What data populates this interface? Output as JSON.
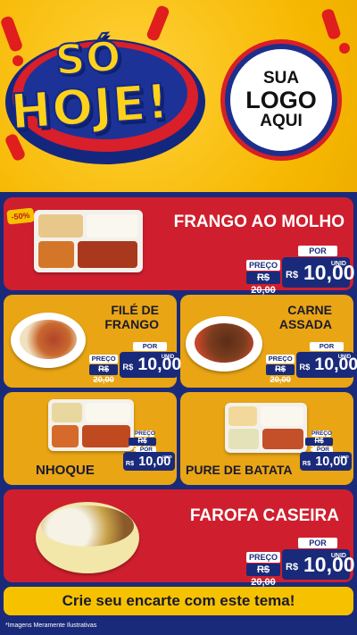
{
  "header": {
    "headline_line1": "SÓ",
    "headline_line2": "HOJE!",
    "logo_line1": "SUA",
    "logo_line2": "LOGO",
    "logo_line3": "AQUI"
  },
  "discount_badge": "-50%",
  "products": [
    {
      "name": "FRANGO AO MOLHO",
      "preco_label": "PREÇO",
      "old_price": "20,00",
      "por_label": "POR",
      "currency": "R$",
      "price": "10,00",
      "unit": "UNID"
    },
    {
      "name_line1": "FILÉ DE",
      "name_line2": "FRANGO",
      "preco_label": "PREÇO",
      "old_price": "20,00",
      "por_label": "POR",
      "currency": "R$",
      "price": "10,00",
      "unit": "UNID"
    },
    {
      "name_line1": "CARNE",
      "name_line2": "ASSADA",
      "preco_label": "PREÇO",
      "old_price": "20,00",
      "por_label": "POR",
      "currency": "R$",
      "price": "10,00",
      "unit": "UNID"
    },
    {
      "name": "NHOQUE",
      "preco_label": "PREÇO",
      "old_price": "20,00",
      "por_label": "POR",
      "currency": "R$",
      "price": "10,00",
      "unit": "UNID"
    },
    {
      "name": "PURE DE BATATA",
      "preco_label": "PREÇO",
      "old_price": "20,00",
      "por_label": "POR",
      "currency": "R$",
      "price": "10,00",
      "unit": "UNID"
    },
    {
      "name": "FAROFA CASEIRA",
      "preco_label": "PREÇO",
      "old_price": "20,00",
      "por_label": "POR",
      "currency": "R$",
      "price": "10,00",
      "unit": "UNID"
    }
  ],
  "old_price_prefix": "R$",
  "cta": "Crie seu encarte com este tema!",
  "footnote": "*Imagens Meramente Ilustrativas",
  "colors": {
    "background": "#1a2a7a",
    "header": "#f6b700",
    "red_card": "#cf1f2e",
    "yellow_card": "#e9a514",
    "accent": "#f6c200"
  }
}
